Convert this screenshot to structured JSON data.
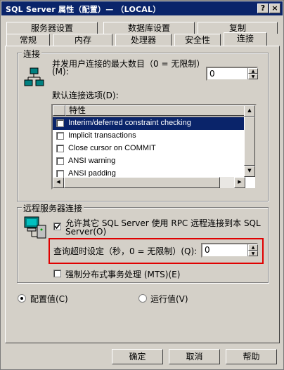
{
  "window": {
    "title": "SQL Server 属性（配置）— （LOCAL）",
    "help_btn": "?",
    "close_btn": "×"
  },
  "tabs_back": [
    "服务器设置",
    "数据库设置",
    "复制"
  ],
  "tabs_front": [
    "常规",
    "内存",
    "处理器",
    "安全性",
    "连接"
  ],
  "connections": {
    "group_title": "连接",
    "max_users_label": "并发用户连接的最大数目（0 = 无限制）",
    "max_users_label2": "(M):",
    "max_users_value": "0",
    "default_options_label": "默认连接选项(D):",
    "list_header": "特性",
    "options": [
      {
        "label": "Interim/deferred constraint checking",
        "checked": false,
        "selected": true
      },
      {
        "label": "Implicit transactions",
        "checked": false,
        "selected": false
      },
      {
        "label": "Close cursor on COMMIT",
        "checked": false,
        "selected": false
      },
      {
        "label": "ANSI warning",
        "checked": false,
        "selected": false
      },
      {
        "label": "ANSI padding",
        "checked": false,
        "selected": false
      }
    ]
  },
  "remote": {
    "group_title": "远程服务器连接",
    "allow_rpc_label": "允许其它 SQL Server 使用 RPC 远程连接到本 SQL",
    "allow_rpc_label2": "Server(O)",
    "allow_rpc_checked": true,
    "timeout_label": "查询超时设定（秒，0 = 无限制）(Q):",
    "timeout_value": "0",
    "dtc_label": "强制分布式事务处理 (MTS)(E)",
    "dtc_checked": false
  },
  "mode": {
    "config_label": "配置值(C)",
    "running_label": "运行值(V)",
    "selected": "config"
  },
  "buttons": {
    "ok": "确定",
    "cancel": "取消",
    "help": "帮助"
  },
  "colors": {
    "titlebar": "#0a246a",
    "face": "#d4d0c8",
    "highlight_box": "#e00000"
  }
}
